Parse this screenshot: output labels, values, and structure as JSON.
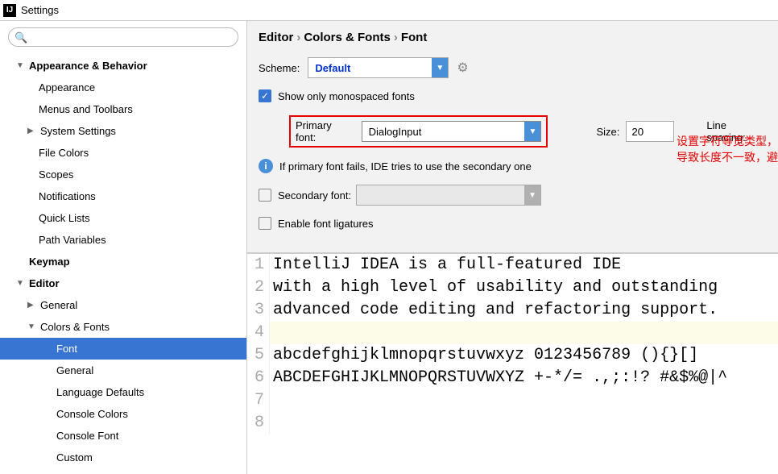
{
  "window": {
    "title": "Settings"
  },
  "search": {
    "placeholder": ""
  },
  "tree": {
    "appearance_behavior": "Appearance & Behavior",
    "appearance": "Appearance",
    "menus_toolbars": "Menus and Toolbars",
    "system_settings": "System Settings",
    "file_colors": "File Colors",
    "scopes": "Scopes",
    "notifications": "Notifications",
    "quick_lists": "Quick Lists",
    "path_variables": "Path Variables",
    "keymap": "Keymap",
    "editor": "Editor",
    "general": "General",
    "colors_fonts": "Colors & Fonts",
    "font": "Font",
    "general2": "General",
    "language_defaults": "Language Defaults",
    "console_colors": "Console Colors",
    "console_font": "Console Font",
    "custom": "Custom"
  },
  "breadcrumb": {
    "a": "Editor",
    "b": "Colors & Fonts",
    "c": "Font"
  },
  "form": {
    "scheme_label": "Scheme:",
    "scheme_value": "Default",
    "show_mono": "Show only monospaced fonts",
    "primary_label": "Primary font:",
    "primary_value": "DialogInput",
    "size_label": "Size:",
    "size_value": "20",
    "ls_label": "Line spacing:",
    "info": "If primary font fails, IDE tries to use the secondary one",
    "secondary_label": "Secondary font:",
    "ligatures": "Enable font ligatures"
  },
  "annotation": "设置字符等宽类型，因为在开发中，一些字符往往会出现中英空格，导致长度不一致，避免不必要的错误。",
  "preview": {
    "l1": "IntelliJ IDEA is a full-featured IDE",
    "l2": "with a high level of usability and outstanding",
    "l3": "advanced code editing and refactoring support.",
    "l4": "",
    "l5": "abcdefghijklmnopqrstuvwxyz 0123456789 (){}[]",
    "l6": "ABCDEFGHIJKLMNOPQRSTUVWXYZ +-*/= .,;:!? #&$%@|^",
    "l7": "",
    "l8": ""
  }
}
